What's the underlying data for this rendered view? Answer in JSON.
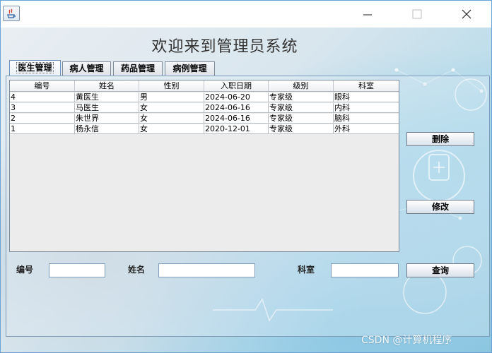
{
  "titlebar": {
    "minimize_icon": "minimize-icon",
    "maximize_icon": "maximize-icon",
    "close_icon": "close-icon"
  },
  "header": {
    "title": "欢迎来到管理员系统"
  },
  "tabs": [
    {
      "label": "医生管理",
      "active": true
    },
    {
      "label": "病人管理",
      "active": false
    },
    {
      "label": "药品管理",
      "active": false
    },
    {
      "label": "病例管理",
      "active": false
    }
  ],
  "table": {
    "columns": [
      "编号",
      "姓名",
      "性别",
      "入职日期",
      "级别",
      "科室"
    ],
    "rows": [
      [
        "4",
        "黄医生",
        "男",
        "2024-06-20",
        "专家级",
        "眼科"
      ],
      [
        "3",
        "马医生",
        "女",
        "2024-06-16",
        "专家级",
        "内科"
      ],
      [
        "2",
        "朱世界",
        "女",
        "2024-06-16",
        "专家级",
        "脑科"
      ],
      [
        "1",
        "杨永信",
        "女",
        "2020-12-01",
        "专家级",
        "外科"
      ]
    ]
  },
  "actions": {
    "delete_label": "删除",
    "edit_label": "修改",
    "query_label": "查询"
  },
  "form": {
    "id_label": "编号",
    "id_value": "",
    "name_label": "姓名",
    "name_value": "",
    "dept_label": "科室",
    "dept_value": ""
  },
  "watermark": "CSDN @计算机程序",
  "colors": {
    "window_border": "#6aa3d8",
    "panel_border": "#7f9db9",
    "background_accent": "#8fc8e0"
  }
}
